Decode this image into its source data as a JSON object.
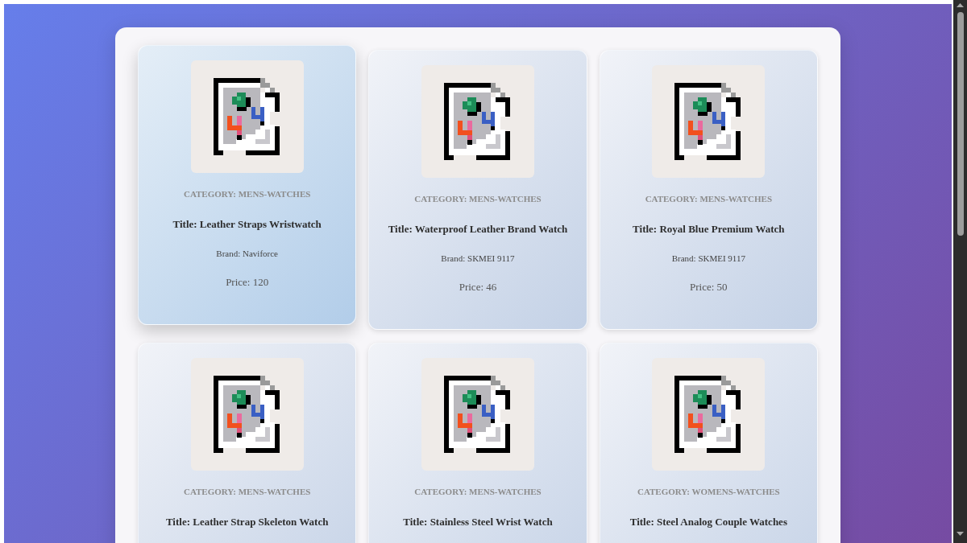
{
  "products": [
    {
      "category": "CATEGORY: MENS-WATCHES",
      "title": "Title: Leather Straps Wristwatch",
      "brand": "Brand: Naviforce",
      "price": "Price: 120",
      "hovered": true
    },
    {
      "category": "CATEGORY: MENS-WATCHES",
      "title": "Title: Waterproof Leather Brand Watch",
      "brand": "Brand: SKMEI 9117",
      "price": "Price: 46",
      "hovered": false
    },
    {
      "category": "CATEGORY: MENS-WATCHES",
      "title": "Title: Royal Blue Premium Watch",
      "brand": "Brand: SKMEI 9117",
      "price": "Price: 50",
      "hovered": false
    },
    {
      "category": "CATEGORY: MENS-WATCHES",
      "title": "Title: Leather Strap Skeleton Watch",
      "hovered": false
    },
    {
      "category": "CATEGORY: MENS-WATCHES",
      "title": "Title: Stainless Steel Wrist Watch",
      "hovered": false
    },
    {
      "category": "CATEGORY: WOMENS-WATCHES",
      "title": "Title: Steel Analog Couple Watches",
      "hovered": false
    }
  ]
}
